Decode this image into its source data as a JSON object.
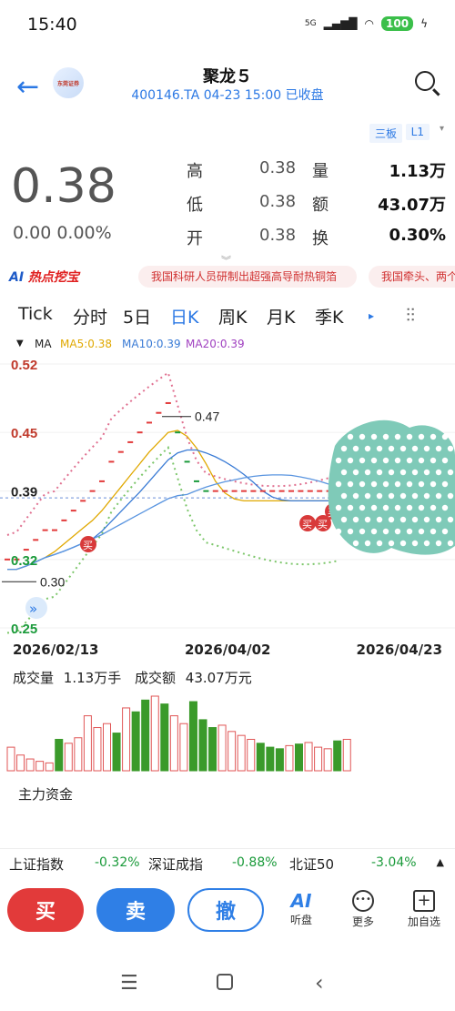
{
  "status": {
    "time": "15:40",
    "network": "5G",
    "battery": "100"
  },
  "header": {
    "title": "聚龙５",
    "subtitle": "400146.TA 04-23 15:00 已收盘",
    "logo_text": "东莞证券"
  },
  "quote": {
    "board_chip": "三板",
    "level_chip": "L1",
    "price": "0.38",
    "change": "0.00 0.00%",
    "rows": [
      {
        "label": "高",
        "value": "0.38",
        "label2": "量",
        "value2": "1.13万"
      },
      {
        "label": "低",
        "value": "0.38",
        "label2": "额",
        "value2": "43.07万"
      },
      {
        "label": "开",
        "value": "0.38",
        "label2": "换",
        "value2": "0.30%"
      }
    ]
  },
  "hot": {
    "tag": "热点挖宝",
    "tag_prefix": "AI",
    "news": [
      "我国科研人员研制出超强高导耐热铜箔",
      "我国牵头、两个"
    ]
  },
  "tabs": [
    "Tick",
    "分时",
    "5日",
    "日K",
    "周K",
    "月K",
    "季K"
  ],
  "active_tab": "日K",
  "ma": {
    "label": "MA",
    "ma5": "MA5:0.38",
    "ma10": "MA10:0.39",
    "ma20": "MA20:0.39",
    "colors": {
      "ma5": "#e0a800",
      "ma10": "#3a7bd5",
      "ma20": "#a040c0"
    }
  },
  "chart_data": {
    "type": "candlestick",
    "y_ticks": [
      "0.52",
      "0.45",
      "0.39",
      "0.32",
      "0.25"
    ],
    "ylim": [
      0.25,
      0.52
    ],
    "annotations": {
      "high": "0.47",
      "low": "0.30",
      "current": "0.39"
    },
    "x_labels": [
      "2026/02/13",
      "2026/04/02",
      "2026/04/23"
    ],
    "close": [
      0.31,
      0.31,
      0.32,
      0.33,
      0.34,
      0.34,
      0.35,
      0.36,
      0.37,
      0.38,
      0.39,
      0.41,
      0.42,
      0.43,
      0.44,
      0.45,
      0.46,
      0.47,
      0.44,
      0.41,
      0.39,
      0.38,
      0.38,
      0.38,
      0.38,
      0.38,
      0.38,
      0.38,
      0.38,
      0.38,
      0.38,
      0.38,
      0.38,
      0.38,
      0.38,
      0.38
    ],
    "buy_marks": [
      "买",
      "买",
      "买",
      "买"
    ],
    "volume": {
      "volume_label": "成交量",
      "volume_value": "1.13万手",
      "amount_label": "成交额",
      "amount_value": "43.07万元",
      "bars": [
        30,
        20,
        15,
        12,
        10,
        40,
        35,
        42,
        70,
        55,
        60,
        48,
        80,
        75,
        90,
        95,
        85,
        70,
        60,
        88,
        65,
        55,
        58,
        50,
        45,
        40,
        35,
        30,
        28,
        32,
        34,
        36,
        30,
        28,
        38,
        40
      ],
      "colors": [
        "r",
        "r",
        "r",
        "r",
        "r",
        "g",
        "r",
        "r",
        "r",
        "r",
        "r",
        "g",
        "r",
        "g",
        "g",
        "r",
        "g",
        "r",
        "r",
        "g",
        "g",
        "g",
        "r",
        "r",
        "r",
        "r",
        "g",
        "g",
        "g",
        "r",
        "g",
        "r",
        "r",
        "r",
        "g",
        "r"
      ]
    }
  },
  "fund": {
    "title": "主力资金"
  },
  "ticker": [
    {
      "name": "上证指数",
      "value": "-0.32%"
    },
    {
      "name": "深证成指",
      "value": "-0.88%"
    },
    {
      "name": "北证50",
      "value": "-3.04%"
    }
  ],
  "actions": {
    "buy": "买",
    "sell": "卖",
    "cancel": "撤",
    "tools": [
      {
        "label": "听盘",
        "icon": "AI"
      },
      {
        "label": "更多",
        "icon": "more"
      },
      {
        "label": "加自选",
        "icon": "add"
      }
    ]
  }
}
